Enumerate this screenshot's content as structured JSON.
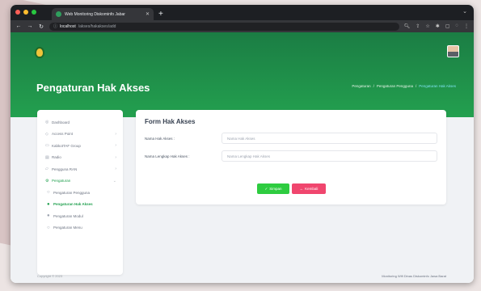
{
  "browser": {
    "tab_title": "Web Monitoring Diskominfo Jabar",
    "url_host": "localhost",
    "url_path": "/akses/hakakses/add",
    "colors": {
      "close": "#ff5f57",
      "minimize": "#febc2e",
      "maximize": "#28c840"
    }
  },
  "header": {
    "page_title": "Pengaturan Hak Akses",
    "breadcrumb": [
      "Pengaturan",
      "/",
      "Pengaturan Pengguna",
      "/",
      "Pengaturan Hak Akses"
    ]
  },
  "sidebar": {
    "items": [
      {
        "icon": "dashboard-icon",
        "label": "Dashboard",
        "chevron": false
      },
      {
        "icon": "access-point-icon",
        "label": "Access Point",
        "chevron": true
      },
      {
        "icon": "group-icon",
        "label": "KabkotTAF Group",
        "chevron": true
      },
      {
        "icon": "radio-icon",
        "label": "Radio",
        "chevron": true
      },
      {
        "icon": "network-icon",
        "label": "Pengguna RAN",
        "chevron": true
      },
      {
        "icon": "settings-icon",
        "label": "Pengaturan",
        "chevron": true
      }
    ],
    "sub_items": [
      {
        "label": "Pengaturan Pengguna"
      },
      {
        "label": "Pengaturan Hak Akses"
      },
      {
        "label": "Pengaturan Modul"
      },
      {
        "label": "Pengaturan Menu"
      }
    ]
  },
  "form": {
    "title": "Form Hak Akses",
    "fields": [
      {
        "label": "Nama Hak Akses :",
        "placeholder": "Nama Hak Akses"
      },
      {
        "label": "Nama Lengkap Hak Akses :",
        "placeholder": "Nama Lengkap Hak Akses"
      }
    ],
    "save_label": "Simpan",
    "cancel_label": "Kembali"
  },
  "footer": {
    "left": "Copyright © 2023",
    "right": "Monitoring Wifi Dinas Diskominfo Jawa Barat"
  }
}
